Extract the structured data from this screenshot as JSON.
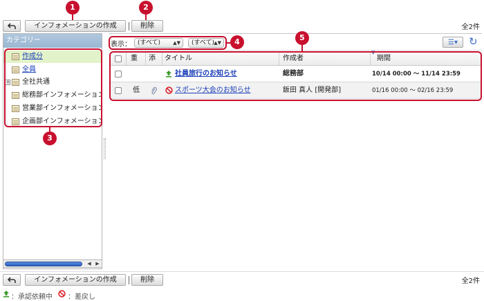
{
  "toolbar": {
    "back_icon": "back-arrow-icon",
    "create_label": "インフォメーションの作成",
    "delete_label": "削除",
    "total_count": "全2件"
  },
  "callouts": {
    "c1": "1",
    "c2": "2",
    "c3": "3",
    "c4": "4",
    "c5": "5"
  },
  "sidebar": {
    "header": "カテゴリー",
    "items": [
      {
        "label": "作成分",
        "link": true,
        "selected": true
      },
      {
        "label": "全員",
        "link": true
      },
      {
        "label": "全社共通",
        "expand": "+"
      },
      {
        "label": "総務部インフォメーション"
      },
      {
        "label": "営業部インフォメーション"
      },
      {
        "label": "企画部インフォメーション"
      }
    ]
  },
  "filter": {
    "label": "表示：",
    "select1": "(すべて)",
    "select2": "(すべて)"
  },
  "table": {
    "headers": {
      "importance": "重",
      "attachment": "添",
      "title": "タイトル",
      "author": "作成者",
      "period": "期間"
    },
    "rows": [
      {
        "importance": "",
        "status_icon": "approval-request-icon",
        "title": "社員旅行のお知らせ",
        "author": "総務部",
        "period": "10/14 00:00 〜 11/14 23:59"
      },
      {
        "importance": "低",
        "attachment_icon": "paperclip-icon",
        "status_icon": "returned-icon",
        "title": "スポーツ大会のお知らせ",
        "author": "飯田 真人 [開発部]",
        "period": "01/16 00:00 〜 02/16 23:59"
      }
    ]
  },
  "legend": {
    "approval": "：承認依頼中",
    "returned": "：差戻し"
  },
  "colors": {
    "callout": "#c8102e",
    "link": "#1a3fb8",
    "approval_icon": "#3a9a2a",
    "returned_icon": "#d9232d"
  }
}
